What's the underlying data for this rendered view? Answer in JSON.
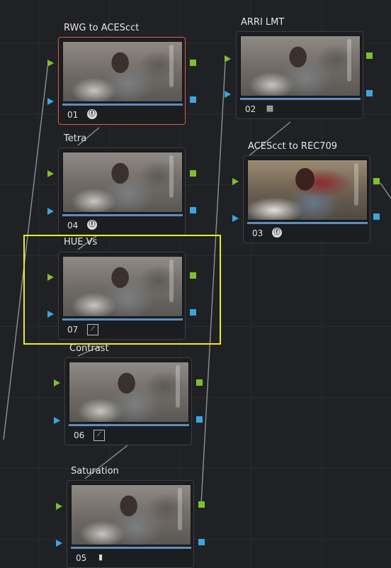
{
  "colors": {
    "background": "#202124",
    "node_border": "#3c3d41",
    "selected_node_border": "#d8604a",
    "rgb_port": "#7ec02c",
    "key_port": "#3aa6e0",
    "selection_box": "#ecec24",
    "wire": "#8f9093"
  },
  "nodes": [
    {
      "label": "RWG to ACEScct",
      "number": "01",
      "type_icon": "fx-icon",
      "selected": true
    },
    {
      "label": "ARRI LMT",
      "number": "02",
      "type_icon": "grid-icon",
      "selected": false
    },
    {
      "label": "ACEScct to REC709",
      "number": "03",
      "type_icon": "fx-icon",
      "selected": false
    },
    {
      "label": "Tetra",
      "number": "04",
      "type_icon": "fx-icon",
      "selected": false
    },
    {
      "label": "Contrast",
      "number": "06",
      "type_icon": "curve-icon",
      "selected": false
    },
    {
      "label": "Saturation",
      "number": "05",
      "type_icon": "sat-bars-icon",
      "selected": false
    },
    {
      "label": "HUE Vs",
      "number": "07",
      "type_icon": "curve-icon",
      "selected": false
    }
  ],
  "icon_glyphs": {
    "fx": "ⓕ",
    "grid": "▦",
    "curve": "⟋",
    "bars": "▮"
  }
}
